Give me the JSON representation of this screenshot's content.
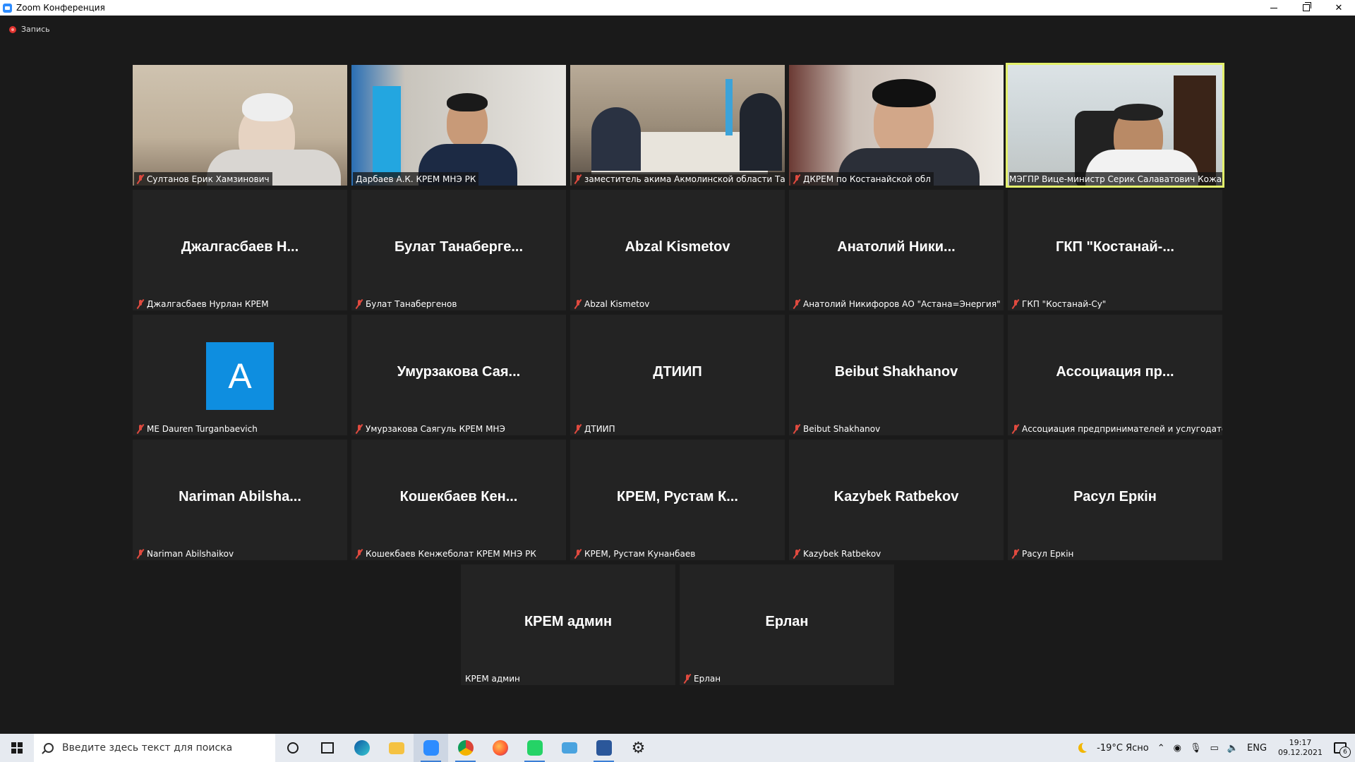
{
  "window": {
    "title": "Zoom Конференция"
  },
  "recording": {
    "label": "Запись",
    "color": "#e0332f"
  },
  "active_speaker_color": "#e3f06b",
  "participants": [
    {
      "label": "Султанов Ерик Хамзинович",
      "bigname": "",
      "muted": true,
      "video": true
    },
    {
      "label": "Дарбаев А.К. КРЕМ МНЭ РК",
      "bigname": "",
      "muted": false,
      "video": true
    },
    {
      "label": "заместитель акима Акмолинской области Та...",
      "bigname": "",
      "muted": true,
      "video": true
    },
    {
      "label": "ДКРЕМ по Костанайской обл",
      "bigname": "",
      "muted": true,
      "video": true
    },
    {
      "label": "МЭГПР Вице-министр Серик Салаватович Кожа...",
      "bigname": "",
      "muted": false,
      "video": true,
      "active": true
    },
    {
      "label": "Джалгасбаев Нурлан КРЕМ",
      "bigname": "Джалгасбаев  Н...",
      "muted": true
    },
    {
      "label": "Булат Танабергенов",
      "bigname": "Булат  Танаберге...",
      "muted": true
    },
    {
      "label": "Abzal Kismetov",
      "bigname": "Abzal Kismetov",
      "muted": true
    },
    {
      "label": "Анатолий Никифоров АО \"Астана=Энергия\"",
      "bigname": "Анатолий  Ники...",
      "muted": true
    },
    {
      "label": "ГКП \"Костанай-Су\"",
      "bigname": "ГКП  \"Костанай-...",
      "muted": true
    },
    {
      "label": "ME Dauren Turganbaevich",
      "bigname": "",
      "avatar": "A",
      "muted": true
    },
    {
      "label": "Умурзакова Саягуль КРЕМ МНЭ",
      "bigname": "Умурзакова  Сая...",
      "muted": true
    },
    {
      "label": "ДТИИП",
      "bigname": "ДТИИП",
      "muted": true
    },
    {
      "label": "Beibut Shakhanov",
      "bigname": "Beibut Shakhanov",
      "muted": true
    },
    {
      "label": "Ассоциация предпринимателей и услугодате...",
      "bigname": "Ассоциация  пр...",
      "muted": true
    },
    {
      "label": "Nariman Abilshaikov",
      "bigname": "Nariman  Abilsha...",
      "muted": true
    },
    {
      "label": "Кошекбаев Кенжеболат КРЕМ МНЭ РК",
      "bigname": "Кошекбаев  Кен...",
      "muted": true
    },
    {
      "label": "КРЕМ, Рустам Кунанбаев",
      "bigname": "КРЕМ,  Рустам К...",
      "muted": true
    },
    {
      "label": "Kazybek Ratbekov",
      "bigname": "Kazybek Ratbekov",
      "muted": true
    },
    {
      "label": "Расул Еркін",
      "bigname": "Расул Еркін",
      "muted": true
    },
    {
      "label": "КРЕМ админ",
      "bigname": "КРЕМ админ",
      "muted": false
    },
    {
      "label": "Ерлан",
      "bigname": "Ерлан",
      "muted": true
    }
  ],
  "taskbar": {
    "search_placeholder": "Введите здесь текст для поиска",
    "weather": "-19°C  Ясно",
    "language": "ENG",
    "time": "19:17",
    "date": "09.12.2021",
    "notifications": "6",
    "apps": [
      "cortana-icon",
      "task-view-icon",
      "edge-icon",
      "file-explorer-icon",
      "zoom-icon",
      "chrome-icon",
      "firefox-icon",
      "whatsapp-icon",
      "remote-desktop-icon",
      "word-icon",
      "settings-icon"
    ]
  }
}
